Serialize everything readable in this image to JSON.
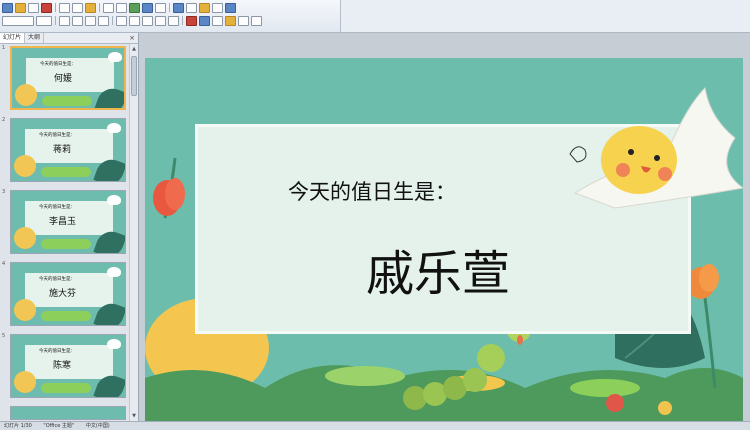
{
  "pane": {
    "tabs": [
      "幻灯片",
      "大纲"
    ],
    "close_glyph": "×"
  },
  "slides": [
    {
      "num": "1",
      "subtitle": "今天的值日生是：",
      "name": "何媛"
    },
    {
      "num": "2",
      "subtitle": "今天的值日生是：",
      "name": "蒋莉"
    },
    {
      "num": "3",
      "subtitle": "今天的值日生是：",
      "name": "李昌玉"
    },
    {
      "num": "4",
      "subtitle": "今天的值日生是：",
      "name": "施大芬"
    },
    {
      "num": "5",
      "subtitle": "今天的值日生是：",
      "name": "陈寒"
    }
  ],
  "main_slide": {
    "subtitle": "今天的值日生是：",
    "name": "戚乐萱"
  },
  "status": {
    "slide_info": "幻灯片 1/30",
    "theme": "\"Office 主题\"",
    "language": "中文(中国)"
  },
  "colors": {
    "slide_bg": "#6dbdac",
    "card_bg": "#e4f2eb",
    "selected_border": "#f0b44c"
  }
}
